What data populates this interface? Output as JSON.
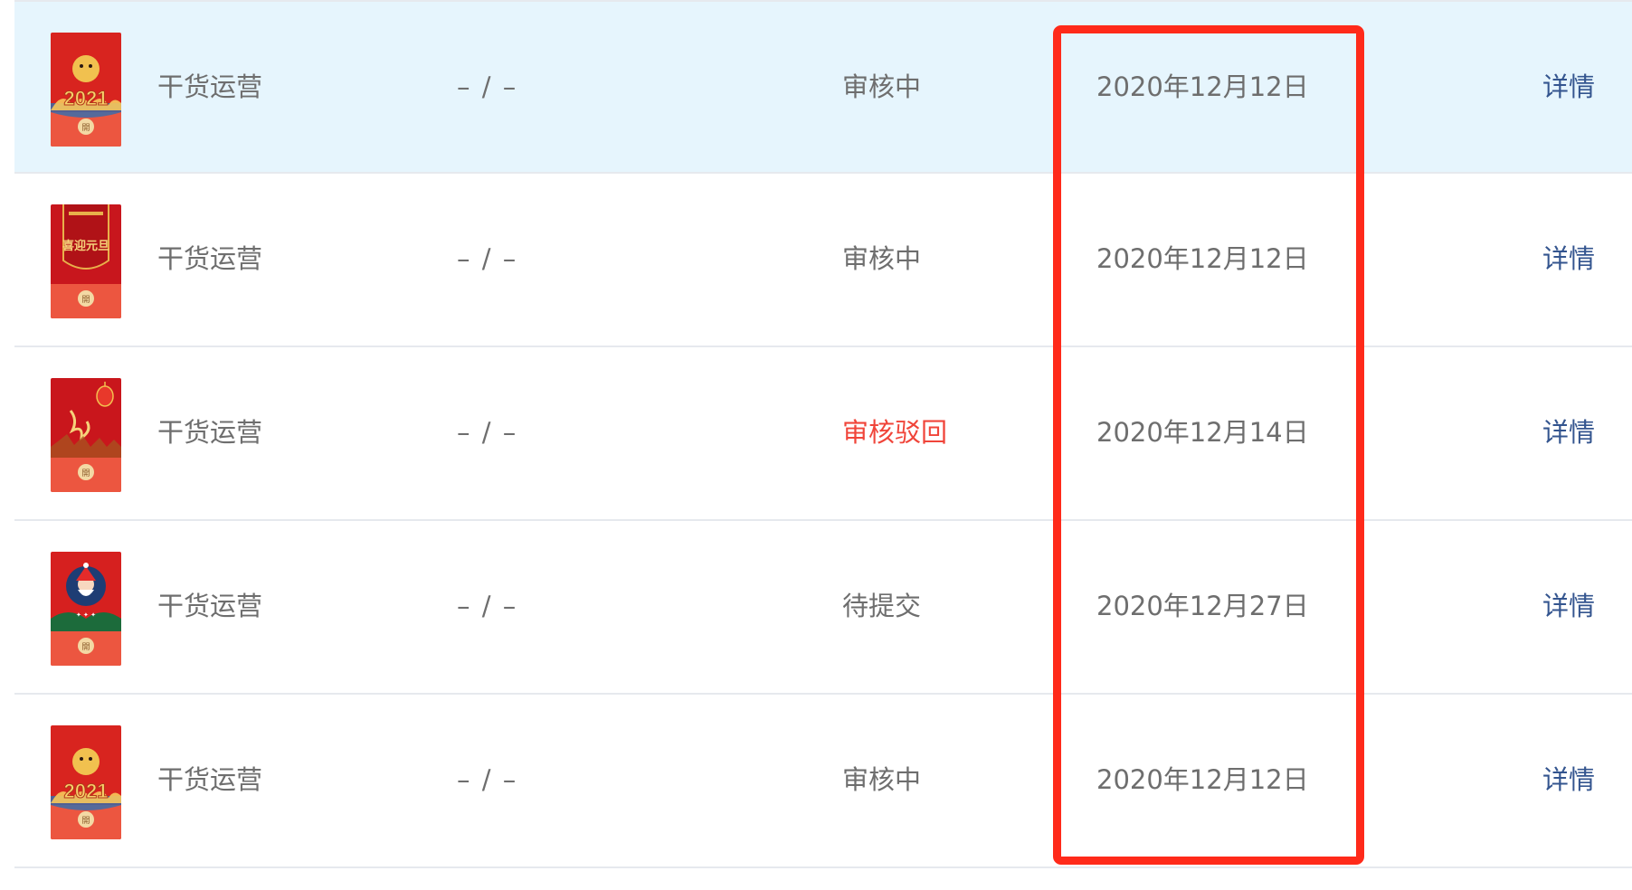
{
  "rows": [
    {
      "name": "干货运营",
      "amount": "– / –",
      "status": "审核中",
      "status_color": "#6e6e6e",
      "date": "2020年12月12日",
      "detail_label": "详情",
      "cover_icon": "red-envelope-2021-icon",
      "cover_text": "2021",
      "seal": "開",
      "highlighted": true
    },
    {
      "name": "干货运营",
      "amount": "– / –",
      "status": "审核中",
      "status_color": "#6e6e6e",
      "date": "2020年12月12日",
      "detail_label": "详情",
      "cover_icon": "red-envelope-new-year-icon",
      "cover_text": "喜迎元旦",
      "seal": "開",
      "highlighted": false
    },
    {
      "name": "干货运营",
      "amount": "– / –",
      "status": "审核驳回",
      "status_color": "#f0453a",
      "date": "2020年12月14日",
      "detail_label": "详情",
      "cover_icon": "red-envelope-lantern-icon",
      "cover_text": "",
      "seal": "開",
      "highlighted": false
    },
    {
      "name": "干货运营",
      "amount": "– / –",
      "status": "待提交",
      "status_color": "#6e6e6e",
      "date": "2020年12月27日",
      "detail_label": "详情",
      "cover_icon": "red-envelope-christmas-icon",
      "cover_text": "",
      "seal": "開",
      "highlighted": false
    },
    {
      "name": "干货运营",
      "amount": "– / –",
      "status": "审核中",
      "status_color": "#6e6e6e",
      "date": "2020年12月12日",
      "detail_label": "详情",
      "cover_icon": "red-envelope-2021-icon",
      "cover_text": "2021",
      "seal": "開",
      "highlighted": false
    }
  ],
  "colors": {
    "highlight_row": "#e6f5fd",
    "link": "#34558f",
    "annotation_frame": "#ff2a1a",
    "text": "#6e6e6e",
    "rejected": "#f0453a"
  }
}
